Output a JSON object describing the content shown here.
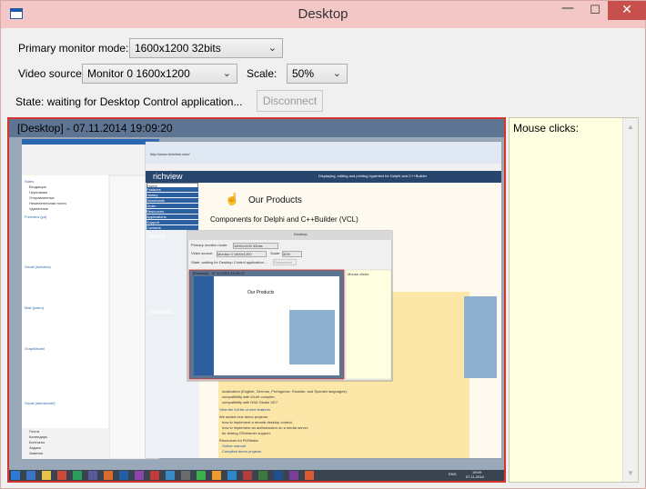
{
  "window": {
    "title": "Desktop",
    "controls": {
      "minimize": "—",
      "maximize": "☐",
      "close": "✕"
    }
  },
  "settings": {
    "monitor_mode_label": "Primary monitor mode:",
    "monitor_mode_value": "1600x1200 32bits",
    "video_source_label": "Video source:",
    "video_source_value": "Monitor 0 1600x1200",
    "scale_label": "Scale:",
    "scale_value": "50%",
    "state_text": "State: waiting for Desktop Control application...",
    "disconnect_label": "Disconnect"
  },
  "preview": {
    "title": "[Desktop] - 07.11.2014 19:09:20",
    "border_color": "#d9342b"
  },
  "mouse_clicks": {
    "title": "Mouse clicks:"
  },
  "icons": {
    "app": "window-icon",
    "dropdown": "chevron-down-icon"
  },
  "remote": {
    "webpage": {
      "site_name": "richview",
      "tagline": "Displaying, editing and printing hypertext for Delphi and C++Builder",
      "product_heading": "Our Products",
      "product_subheading": "Components for Delphi and C++Builder (VCL)",
      "nav_items": [
        "Home",
        "Features",
        "History",
        "Downloads",
        "Order",
        "Resources",
        "Applications",
        "Support",
        "Contacts",
        "How to",
        "Download"
      ],
      "section_title": "We added new demo projects:",
      "demo_items": [
        "how to implement a remote desktop control;",
        "how to implement an authorization on a media server;",
        "for testing GStreamer support."
      ],
      "resources_title": "Resources for RVMedia:",
      "resources_items": [
        "Online manual",
        "Compiled demo projects"
      ],
      "compat_items": [
        "compatibility with 64-bit compiler;",
        "compatibility with RAD Studio XE7."
      ],
      "localized_text": "localization (English, German, Portuguese, Russian, and Spanish languages);",
      "view_list": "View the full list of new features"
    },
    "mail": {
      "folders": [
        "Входящие",
        "Черновики",
        "Отправленные",
        "Нежелательная почта",
        "Удаленные"
      ],
      "groups": [
        "Sales",
        "Freeview (ya)",
        "Gmail (richview)",
        "Mail (yobro)",
        "GraphModel",
        "Gmail (steeskedef)"
      ],
      "bottom_nav": [
        "Почта",
        "Календарь",
        "Контакты",
        "Задачи",
        "Заметки"
      ]
    },
    "nested_window": {
      "title": "Desktop",
      "monitor_label": "Primary monitor mode:",
      "monitor_value": "1600x1200 32bits",
      "source_label": "Video source:",
      "source_value": "Monitor 0 1600x1200",
      "scale_label": "Scale:",
      "scale_value": "50%",
      "state_text": "State: waiting for Desktop Control application...",
      "disconnect_label": "Disconnect",
      "preview_title": "[Desktop] - 07.11.2014 19:09:12",
      "mouse_label": "Mouse clicks:",
      "product_heading": "Our Products"
    },
    "taskbar": {
      "time": "19:09",
      "date": "07.11.2014",
      "lang": "ENG"
    }
  }
}
